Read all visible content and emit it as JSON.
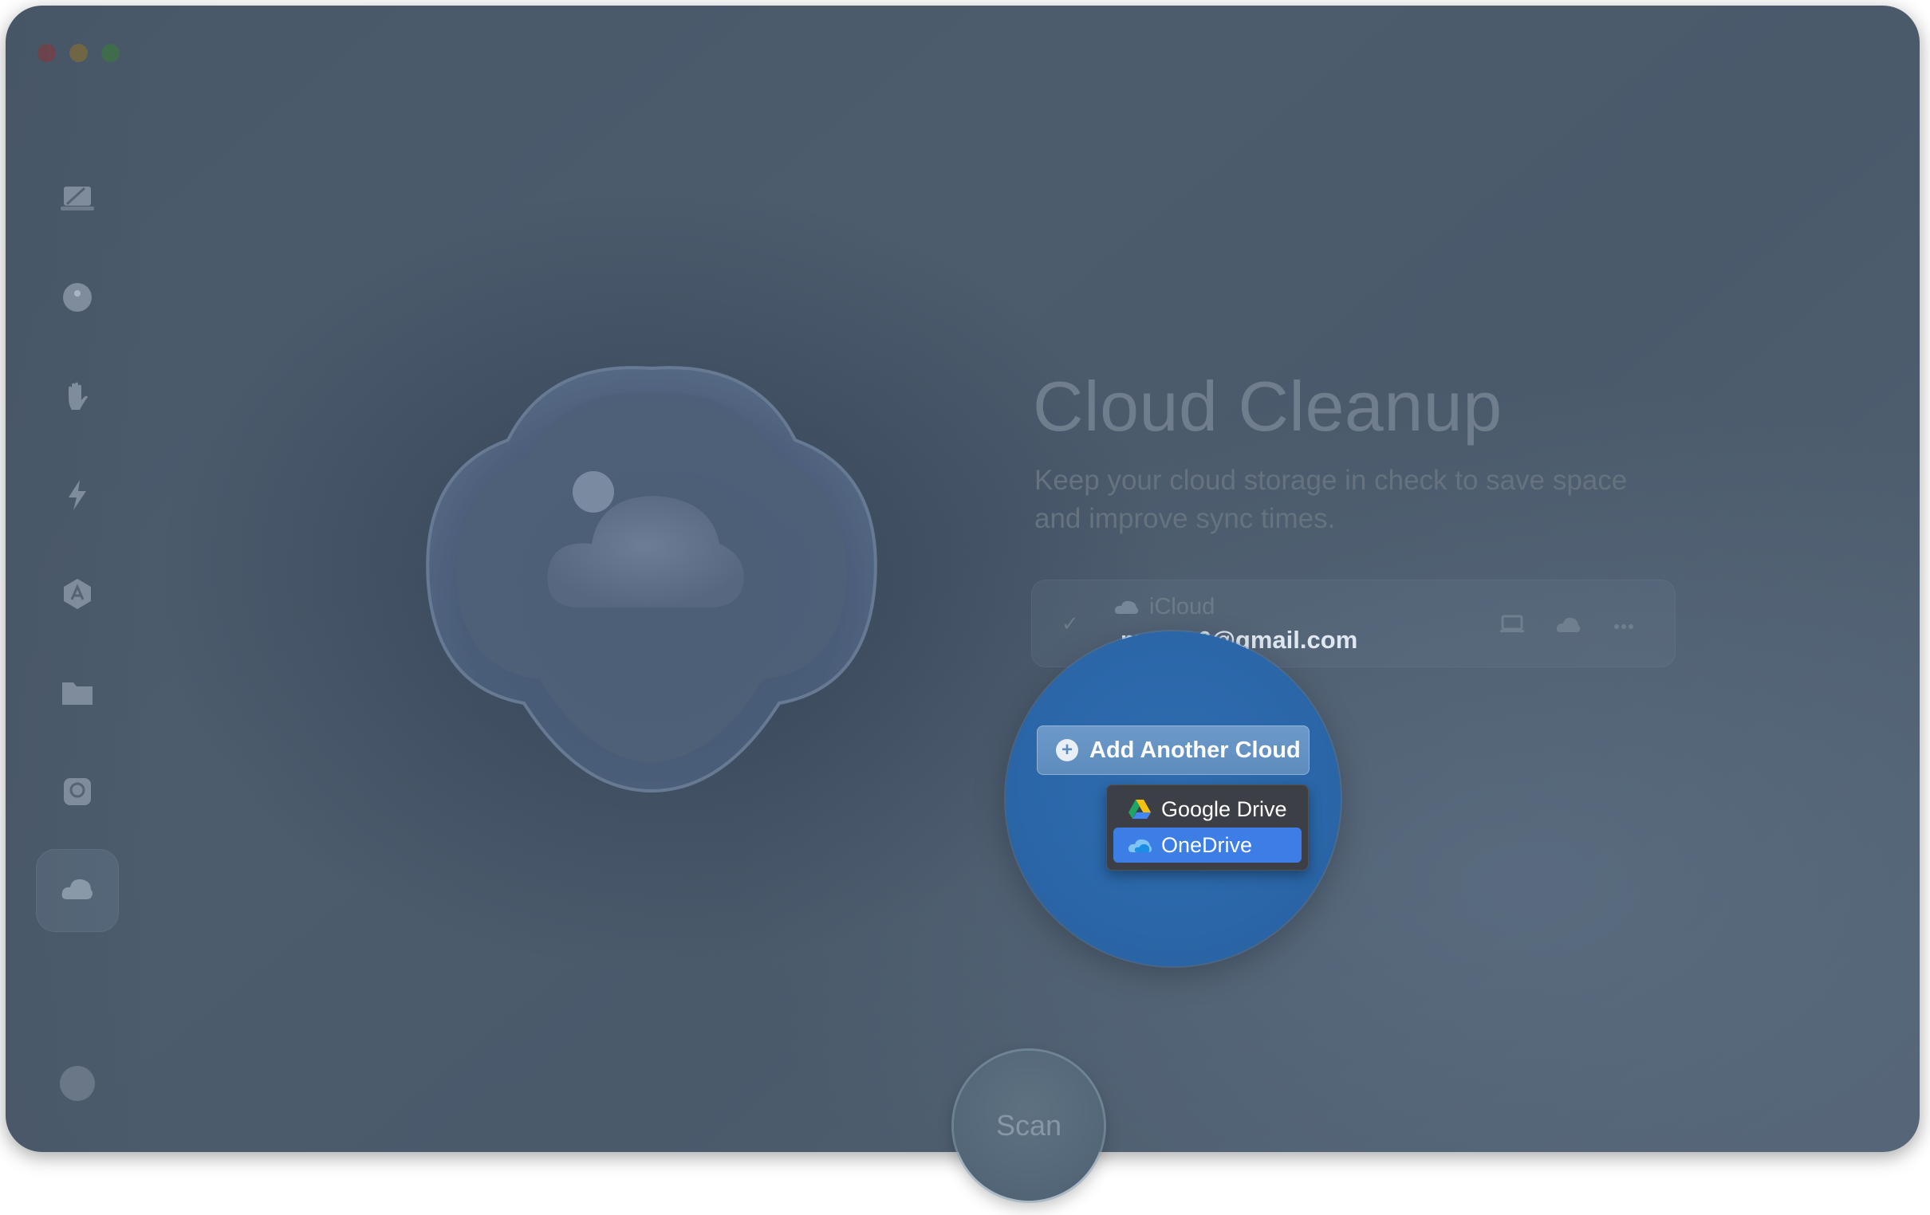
{
  "window": {
    "traffic_lights": [
      "close",
      "minimize",
      "zoom"
    ]
  },
  "sidebar": {
    "items": [
      {
        "name": "smart-care",
        "icon": "laptop-icon"
      },
      {
        "name": "cleanup",
        "icon": "sphere-icon"
      },
      {
        "name": "protection",
        "icon": "hand-icon"
      },
      {
        "name": "performance",
        "icon": "lightning-icon"
      },
      {
        "name": "applications",
        "icon": "apps-icon"
      },
      {
        "name": "my-clutter",
        "icon": "folder-icon"
      },
      {
        "name": "space-lens",
        "icon": "disk-icon"
      },
      {
        "name": "cloud-cleanup",
        "icon": "cloud-icon",
        "active": true
      }
    ],
    "account_icon": "account-toggle-icon"
  },
  "main": {
    "title": "Cloud Cleanup",
    "subtitle": "Keep your cloud storage in check to save space and improve sync times.",
    "account": {
      "checked": true,
      "provider": "iCloud",
      "email": "m        6@gmail.com",
      "actions": [
        "laptop-icon",
        "cloud-icon",
        "more-icon"
      ]
    },
    "add_cloud": {
      "label": "Add Another Cloud"
    },
    "dropdown": {
      "options": [
        "Google Drive",
        "OneDrive"
      ],
      "highlighted": "OneDrive"
    },
    "scan_button": "Scan"
  },
  "colors": {
    "highlight": "#3c7ee6",
    "magnifier": "#2a66a8",
    "background": "#4a5a6b"
  }
}
